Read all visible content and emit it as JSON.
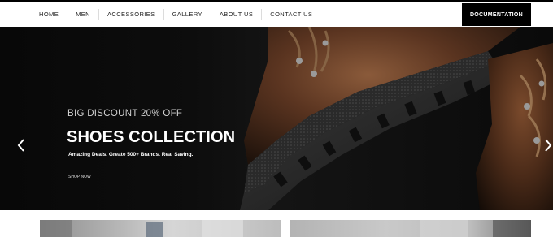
{
  "nav": {
    "items": [
      {
        "label": "HOME"
      },
      {
        "label": "MEN"
      },
      {
        "label": "ACCESSORIES"
      },
      {
        "label": "GALLERY"
      },
      {
        "label": "ABOUT US"
      },
      {
        "label": "CONTACT US"
      }
    ],
    "cta_label": "DOCUMENTATION"
  },
  "hero": {
    "subtitle": "BIG DISCOUNT 20% OFF",
    "title": "SHOES COLLECTION",
    "tagline": "Amazing Deals. Greate 500+ Brands. Real Saving.",
    "link_label": "SHOP NOW",
    "prev_icon": "chevron-left-icon",
    "next_icon": "chevron-right-icon"
  },
  "colors": {
    "nav_bg": "#ffffff",
    "cta_bg": "#000000",
    "hero_bg": "#0b0b0b",
    "boot_leather": "#5a3420"
  }
}
